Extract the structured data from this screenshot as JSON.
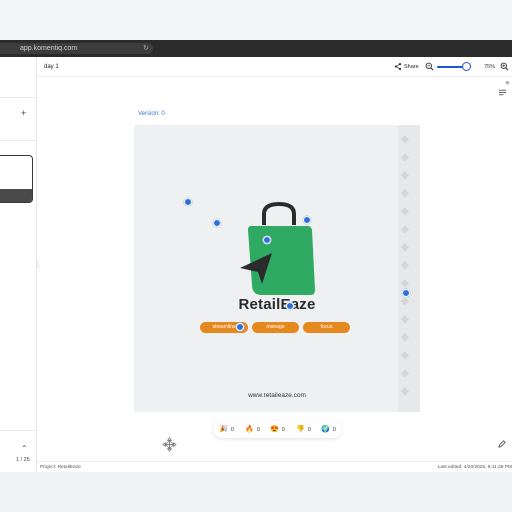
{
  "browser": {
    "url": "app.komentiq.com"
  },
  "header": {
    "title": "day 1",
    "share_label": "Share",
    "zoom_level": "75%",
    "zoom_fraction": 0.75
  },
  "sidebar": {
    "page_indicator": "1 / 25"
  },
  "canvas": {
    "version_label": "Version: 0",
    "brand_name": "RetailEaze",
    "chips": [
      "streamline",
      "manage",
      "focus"
    ],
    "website": "www.retaileaze.com"
  },
  "reactions": [
    {
      "icon": "party-popper-icon",
      "emoji": "🎉",
      "count": "0"
    },
    {
      "icon": "fire-icon",
      "emoji": "🔥",
      "count": "0"
    },
    {
      "icon": "heart-eyes-icon",
      "emoji": "😍",
      "count": "0"
    },
    {
      "icon": "thumbs-down-icon",
      "emoji": "👎",
      "count": "0"
    },
    {
      "icon": "globe-icon",
      "emoji": "🌍",
      "count": "0"
    }
  ],
  "footer": {
    "project": "Project: RetailEaze",
    "last_edited": "Last edited: 4/20/2025, 9:11:29 PM"
  },
  "colors": {
    "accent": "#1e56d6",
    "brand_green": "#2eaa62",
    "chip_orange": "#e5891f",
    "marker_blue": "#2f6fd8"
  }
}
